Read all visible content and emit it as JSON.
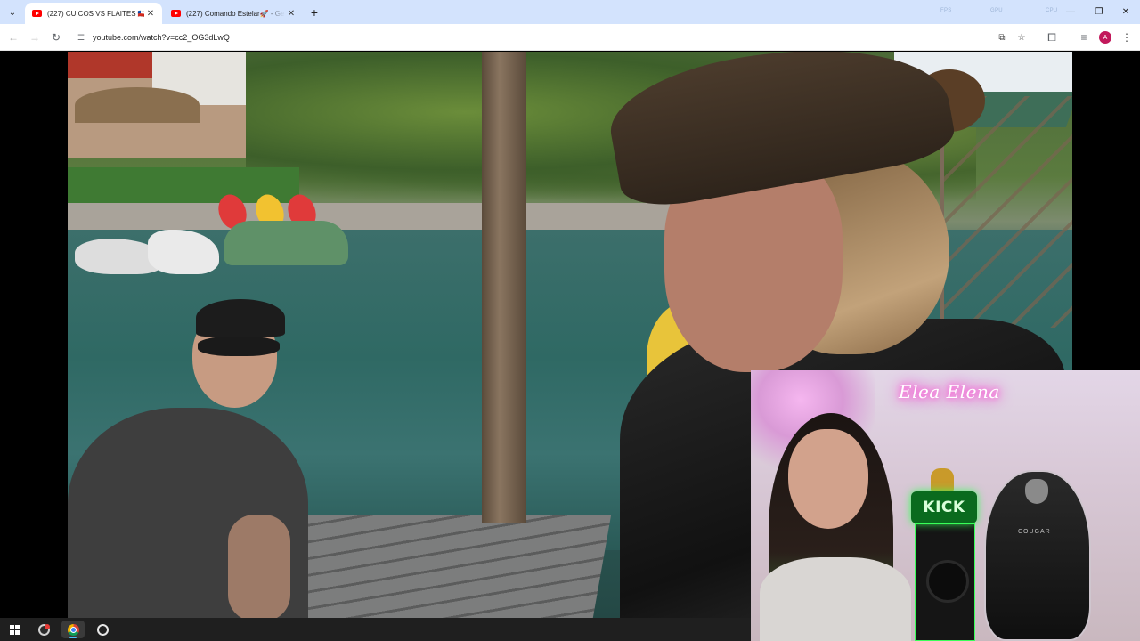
{
  "browser": {
    "tabs": [
      {
        "title": "(227) CUICOS VS FLAITES 🇨🇱 💻",
        "active": true
      },
      {
        "title": "(227) Comando Estelar🚀 - Ge",
        "active": false
      }
    ],
    "new_tab_label": "+",
    "url": "youtube.com/watch?v=cc2_OG3dLwQ",
    "profile_initial": "A",
    "system_monitor": [
      "FPS",
      "GPU",
      "CPU"
    ]
  },
  "webcam": {
    "neon_sign": "Elea Elena",
    "kick_logo": "KICK",
    "chair_brand": "COUGAR"
  },
  "taskbar": {
    "items": [
      "start",
      "obs",
      "chrome",
      "recorder"
    ],
    "active_item": "chrome"
  },
  "colors": {
    "tabstrip": "#d3e3fd",
    "youtube_red": "#ff0000",
    "neon_pink": "#ff3ccf",
    "kick_green": "#39ff59",
    "taskbar": "#1f1f1f"
  }
}
